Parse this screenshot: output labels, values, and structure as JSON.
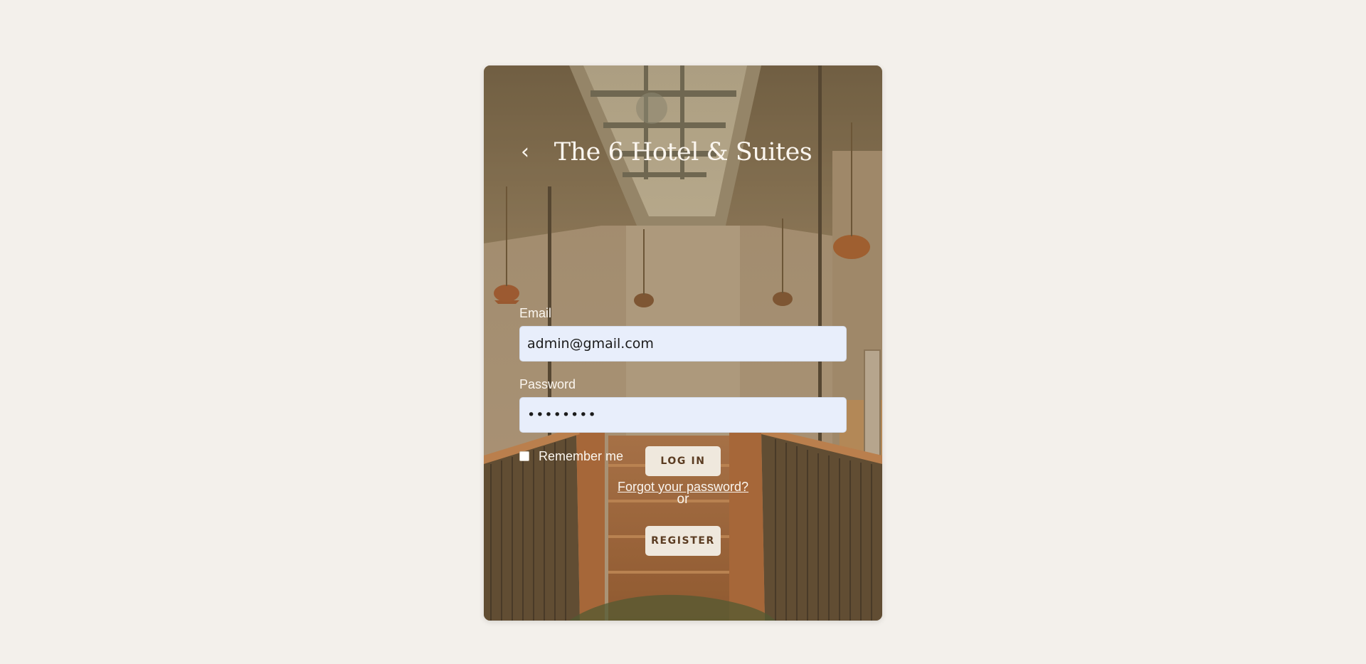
{
  "header": {
    "title": "The 6 Hotel & Suites",
    "back_icon": "chevron-left-icon",
    "back_glyph": "‹"
  },
  "form": {
    "email_label": "Email",
    "email_value": "admin@gmail.com",
    "password_label": "Password",
    "password_value": "••••••••",
    "remember_label": "Remember me",
    "remember_checked": false,
    "forgot_link": "Forgot your password?",
    "login_button": "LOG IN",
    "or_text": "or",
    "register_button": "REGISTER"
  },
  "colors": {
    "page_background": "#f3f0eb",
    "card_text": "#fbf6ef",
    "input_background": "#e8eefb",
    "button_background": "#efe8dd",
    "button_text": "#5b3c22"
  }
}
